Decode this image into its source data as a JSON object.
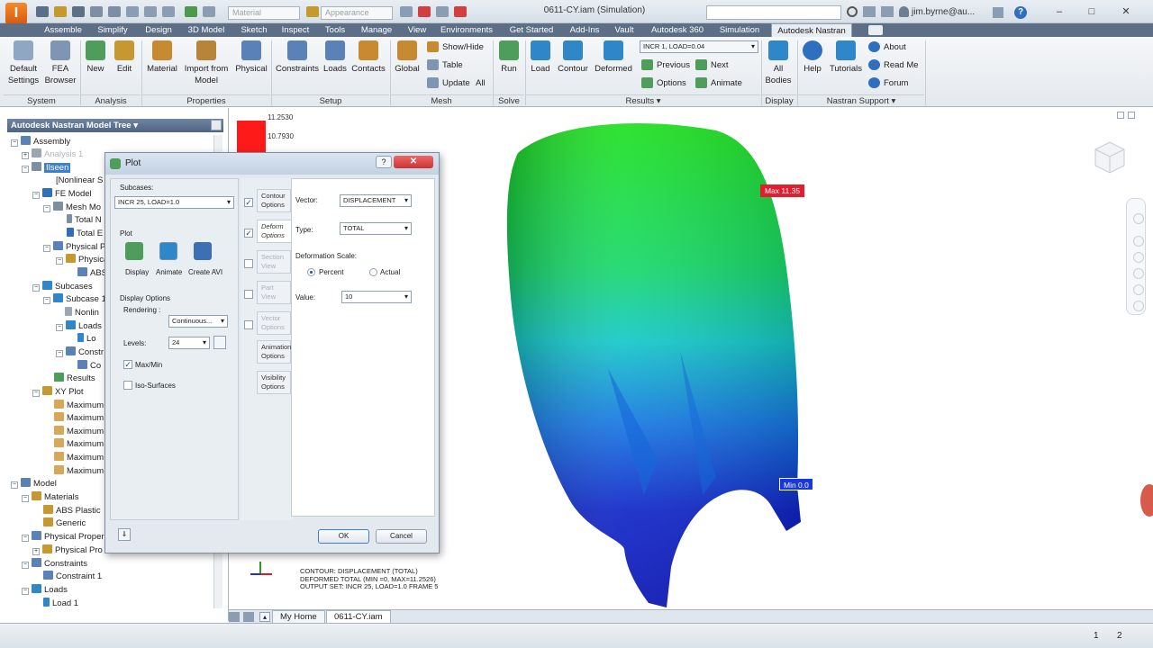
{
  "app": {
    "doc_title": "0611-CY.iam (Simulation)",
    "material_combo": "Material",
    "appearance_combo": "Appearance",
    "user": "jim.byrne@au...",
    "logo_letter": "I"
  },
  "tabs": [
    "Assemble",
    "Simplify",
    "Design",
    "3D Model",
    "Sketch",
    "Inspect",
    "Tools",
    "Manage",
    "View",
    "Environments",
    "Get Started",
    "Add-Ins",
    "Vault",
    "Autodesk 360",
    "Simulation",
    "Autodesk Nastran"
  ],
  "ribbon": {
    "default_settings": "Default\nSettings",
    "fea_browser": "FEA\nBrowser",
    "new": "New",
    "edit": "Edit",
    "material": "Material",
    "import_from_model": "Import from\nModel",
    "physical": "Physical",
    "constraints": "Constraints",
    "loads": "Loads",
    "contacts": "Contacts",
    "global": "Global",
    "show_hide": "Show/Hide",
    "table": "Table",
    "update": "Update",
    "all": "All",
    "run": "Run",
    "load": "Load",
    "contour": "Contour",
    "deformed": "Deformed",
    "results_combo": "INCR 1, LOAD=0.04",
    "previous": "Previous",
    "next": "Next",
    "options": "Options",
    "animate": "Animate",
    "all_bodies": "All\nBodies",
    "help": "Help",
    "tutorials": "Tutorials",
    "about": "About",
    "read_me": "Read Me",
    "forum": "Forum",
    "panels": {
      "system": "System",
      "analysis": "Analysis",
      "properties": "Properties",
      "setup": "Setup",
      "mesh": "Mesh",
      "solve": "Solve",
      "results": "Results ▾",
      "display": "Display",
      "nastran_support": "Nastran Support ▾"
    }
  },
  "tree": {
    "header": "Autodesk Nastran Model Tree ▾",
    "nodes": [
      {
        "label": "Assembly"
      },
      {
        "label": "Analysis 1"
      },
      {
        "label": "Ilseen"
      },
      {
        "label": "[Nonlinear S"
      },
      {
        "label": "FE Model"
      },
      {
        "label": "Mesh Mo"
      },
      {
        "label": "Total N"
      },
      {
        "label": "Total E"
      },
      {
        "label": "Physical P"
      },
      {
        "label": "Physica"
      },
      {
        "label": "ABS"
      },
      {
        "label": "Subcases"
      },
      {
        "label": "Subcase 1"
      },
      {
        "label": "Nonlin"
      },
      {
        "label": "Loads"
      },
      {
        "label": "Lo"
      },
      {
        "label": "Constr"
      },
      {
        "label": "Co"
      },
      {
        "label": "Results"
      },
      {
        "label": "XY Plot"
      },
      {
        "label": "Maximum"
      },
      {
        "label": "Maximum"
      },
      {
        "label": "Maximum"
      },
      {
        "label": "Maximum"
      },
      {
        "label": "Maximum"
      },
      {
        "label": "Maximum"
      },
      {
        "label": "Model"
      },
      {
        "label": "Materials"
      },
      {
        "label": "ABS Plastic"
      },
      {
        "label": "Generic"
      },
      {
        "label": "Physical Proper"
      },
      {
        "label": "Physical Pro"
      },
      {
        "label": "Constraints"
      },
      {
        "label": "Constraint 1"
      },
      {
        "label": "Loads"
      },
      {
        "label": "Load 1"
      }
    ]
  },
  "dialog": {
    "title": "Plot",
    "subcases_label": "Subcases:",
    "subcase_value": "INCR 25, LOAD=1.0",
    "plot_label": "Plot",
    "display": "Display",
    "animate": "Animate",
    "create_avi": "Create AVI",
    "display_options": "Display Options",
    "rendering_label": "Rendering :",
    "rendering_value": "Continuous...",
    "levels_label": "Levels:",
    "levels_value": "24",
    "maxmin": "Max/Min",
    "iso_surfaces": "Iso-Surfaces",
    "vtabs": [
      "Contour Options",
      "Deform Options",
      "Section View",
      "Part View",
      "Vector Options",
      "Animation Options",
      "Visibility Options"
    ],
    "vector_label": "Vector:",
    "vector_value": "DISPLACEMENT",
    "type_label": "Type:",
    "type_value": "TOTAL",
    "deformation_scale": "Deformation Scale:",
    "percent": "Percent",
    "actual": "Actual",
    "value_label": "Value:",
    "value_value": "10",
    "ok": "OK",
    "cancel": "Cancel"
  },
  "viewport": {
    "legend_top": "11.2530",
    "legend_second": "10.7930",
    "max_label": "Max 11.35",
    "min_label": "Min 0.0",
    "info_line1": "CONTOUR: DISPLACEMENT (TOTAL)",
    "info_line2": "DEFORMED TOTAL (MIN    =0, MAX=11.2526)",
    "info_line3": "OUTPUT SET: INCR 25, LOAD=1.0   FRAME     5"
  },
  "doc_tabs": [
    "My Home",
    "0611-CY.iam"
  ],
  "status": {
    "left_num": "1",
    "right_num": "2"
  }
}
